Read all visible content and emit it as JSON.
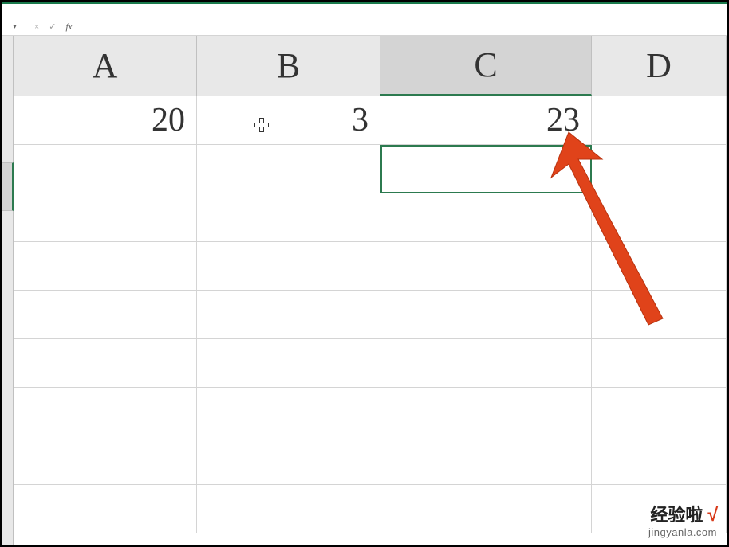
{
  "formula_bar": {
    "cancel_icon": "×",
    "accept_icon": "✓",
    "fx_label": "fx",
    "input_value": ""
  },
  "columns": {
    "a": "A",
    "b": "B",
    "c": "C",
    "d": "D"
  },
  "cells": {
    "a1": "20",
    "b1": "3",
    "c1": "23"
  },
  "selected_cell_ref": "C2",
  "watermark": {
    "main": "经验啦",
    "check": "√",
    "url": "jingyanla.com"
  }
}
